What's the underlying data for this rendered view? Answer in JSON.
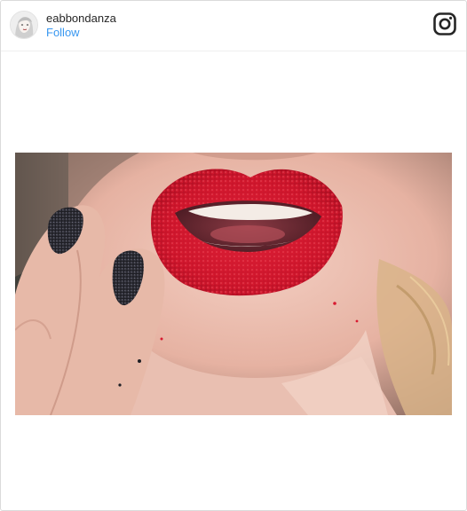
{
  "post": {
    "username": "eabbondanza",
    "follow_label": "Follow"
  },
  "icons": {
    "logo": "instagram-icon",
    "avatar": "profile-avatar"
  },
  "colors": {
    "link_blue": "#3897f0",
    "username_text": "#262626",
    "border": "#dbdbdb"
  }
}
